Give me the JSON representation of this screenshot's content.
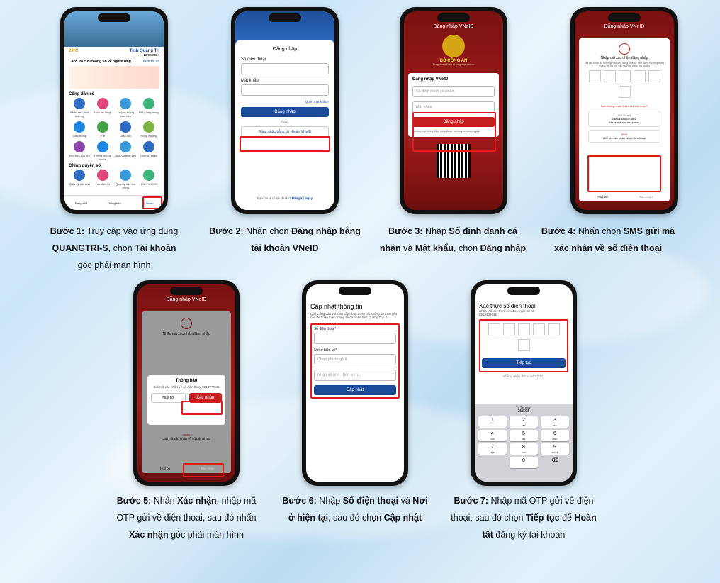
{
  "steps": [
    {
      "label": "Bước 1:",
      "t1": " Truy cập vào ứng dụng ",
      "b1": "QUANGTRI-S",
      "t2": ", chọn ",
      "b2": "Tài khoản",
      "t3": " góc phải màn hình"
    },
    {
      "label": "Bước 2:",
      "t1": " Nhấn chọn ",
      "b1": "Đăng nhập bằng tài khoản VNeID",
      "t2": "",
      "b2": "",
      "t3": ""
    },
    {
      "label": "Bước 3:",
      "t1": " Nhập ",
      "b1": "Số định danh cá nhân",
      "t2": " và ",
      "b2": "Mật khẩu",
      "t3": ", chọn ",
      "b3": "Đăng nhập"
    },
    {
      "label": "Bước 4:",
      "t1": " Nhấn chọn ",
      "b1": "SMS gửi mã xác nhận về số điện thoại",
      "t2": "",
      "b2": "",
      "t3": ""
    },
    {
      "label": "Bước 5:",
      "t1": " Nhấn ",
      "b1": "Xác nhận",
      "t2": ", nhập mã OTP gửi về điện thoại, sau đó nhấn ",
      "b2": "Xác nhận",
      "t3": " góc phải màn hình"
    },
    {
      "label": "Bước 6:",
      "t1": " Nhập ",
      "b1": "Số điện thoại",
      "t2": " và ",
      "b2": "Nơi ở hiện tại",
      "t3": ", sau đó chọn ",
      "b3": "Cập nhật"
    },
    {
      "label": "Bước 7:",
      "t1": " Nhập mã OTP gửi về điện thoại, sau đó chọn ",
      "b1": "Tiếp tục",
      "t2": " để ",
      "b2": "Hoàn tất",
      "t3": " đăng ký tài khoản"
    }
  ],
  "phone1": {
    "temp": "29°C",
    "place": "Tỉnh Quảng Trị",
    "date": "12/03/2024",
    "news_title": "Cách tra cứu thông tin về người ứng...",
    "see_all": "Xem tất cả",
    "section1": "Công dân số",
    "section2": "Chính quyền số",
    "icons1": [
      "Phản ánh hiện trường",
      "Dịch vụ công",
      "Truyền thông cảm bản",
      "Đặt ý ứng dụng",
      "Giao thông",
      "Y tế",
      "Giáo dục",
      "Nông nghiệp",
      "Văn hóa, Du lịch",
      "Thông tin quy hoạch",
      "Dịch vụ thiết yếu",
      "Dịch vụ khác"
    ],
    "icons2": [
      "Quản lý văn bản",
      "Thư điện tử",
      "Quản lý văn thư (IOV)",
      "KULY - CDS"
    ],
    "nav": [
      "Trang chủ",
      "Thông báo",
      "Tài khoản"
    ]
  },
  "phone2": {
    "title": "Đăng nhập",
    "phone_label": "Số điện thoại",
    "pw_label": "Mật khẩu",
    "forgot": "Quên mật khẩu?",
    "login": "Đăng nhập",
    "or": "hoặc",
    "vneid": "Đăng nhập bằng tài khoản VNeID",
    "no_account": "Bạn chưa có tài khoản?",
    "register": "Đăng ký ngay"
  },
  "phone3": {
    "header": "Đăng nhập VNeID",
    "ministry": "BỘ CÔNG AN",
    "sub": "Trung tâm dữ liệu Quốc gia về dân cư",
    "card_title": "Đăng nhập VNeID",
    "id_ph": "Số định danh cá nhân",
    "pw_ph": "Mật khẩu",
    "login": "Đăng nhập",
    "help": "Trường hợp không đăng nhập được, vui lòng xem hướng dẫn"
  },
  "phone4": {
    "header": "Đăng nhập VNeID",
    "title": "Nhập mã xác nhận đăng nhập",
    "desc": "Mã xác nhận đã được gửi về ứng dụng VNeID. Tiến hành mở ứng dụng VNeID để lấy mã xác nhận và nhập mã tại đây",
    "not_received": "Bạn không nhận được mã xác nhận?",
    "opt1": "Gửi lại mã",
    "opt1b": "Gửi lại sau 02:48 ⏱",
    "opt1c": "Nhận mã xác nhận mới",
    "sms": "SMS",
    "sms_desc": "Gửi mã xác nhận về số điện thoại",
    "cancel": "Huỷ bỏ",
    "confirm": "Xác nhận"
  },
  "phone5": {
    "header": "Đăng nhập VNeID",
    "title": "Nhập mã xác nhận đăng nhập",
    "notice": "Thông báo",
    "notice_desc": "Gửi mã xác nhận về số điện thoại 0914****045",
    "cancel": "Huỷ bỏ",
    "confirm": "Xác nhận",
    "sms": "SMS",
    "sms_desc": "Gửi mã xác nhận về số điện thoại",
    "cancel2": "Huỷ bỏ",
    "confirm2": "Xác nhận"
  },
  "phone6": {
    "title": "Cập nhật thông tin",
    "desc": "Quý Công dân vui lòng cập nhập thêm các thông tin theo yêu cầu để hoàn thiện thông tin cá nhân trên Quảng Trị - S.",
    "phone_label": "Số điện thoại*",
    "addr_label": "Nơi ở hiện tại*",
    "ward_ph": "Chọn phường/xã",
    "street_ph": "Nhập số nhà, thôn xóm...",
    "update": "Cập nhật"
  },
  "phone7": {
    "title": "Xác thực số điện thoại",
    "desc": "Nhập mã xác thực vừa được gửi tới số",
    "number": "0914402045",
    "continue": "Tiếp tục",
    "resend": "Không nhận được mã? (50s)",
    "suggest_label": "Từ Tin nhắn",
    "suggest_code": "253035",
    "keys": [
      "1",
      "2",
      "3",
      "4",
      "5",
      "6",
      "7",
      "8",
      "9",
      "0"
    ],
    "subs": [
      "",
      "ABC",
      "DEF",
      "GHI",
      "JKL",
      "MNO",
      "PQRS",
      "TUV",
      "WXYZ",
      ""
    ]
  }
}
